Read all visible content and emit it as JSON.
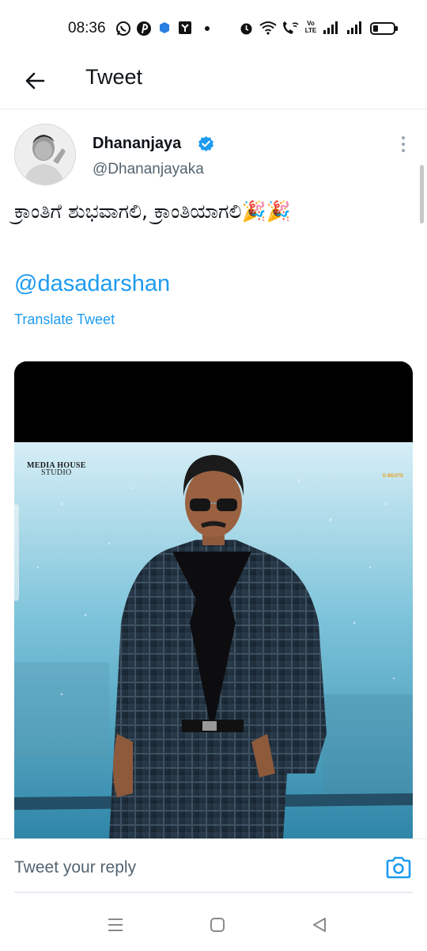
{
  "status_bar": {
    "time": "08:36",
    "network_label": "Vo LTE",
    "icons": [
      "whatsapp-icon",
      "pinterest-icon",
      "app-icon",
      "shop-icon",
      "dot-icon",
      "alarm-icon",
      "wifi-icon",
      "wifi-calling-icon",
      "volte-icon",
      "signal-icon",
      "signal-icon",
      "battery-icon"
    ]
  },
  "header": {
    "title": "Tweet",
    "back_icon": "arrow-left-icon"
  },
  "tweet": {
    "author_name": "Dhananjaya",
    "author_handle": "@Dhananjayaka",
    "verified": true,
    "text": "ಕ್ರಾಂತಿಗೆ ಶುಭವಾಗಲಿ, ಕ್ರಾಂತಿಯಾಗಲಿ🎉🎉",
    "mention": "@dasadarshan",
    "translate_label": "Translate Tweet"
  },
  "media": {
    "left_logo_line1": "MEDIA HOUSE",
    "left_logo_line2": "STUDIO",
    "right_logo": "D BEATS"
  },
  "reply": {
    "placeholder": "Tweet your reply",
    "camera_icon": "camera-icon"
  },
  "nav_bar": {
    "icons": [
      "menu-icon",
      "home-square-icon",
      "back-triangle-icon"
    ]
  },
  "colors": {
    "accent": "#1d9bf0",
    "text_primary": "#0f1419",
    "text_secondary": "#536471"
  }
}
